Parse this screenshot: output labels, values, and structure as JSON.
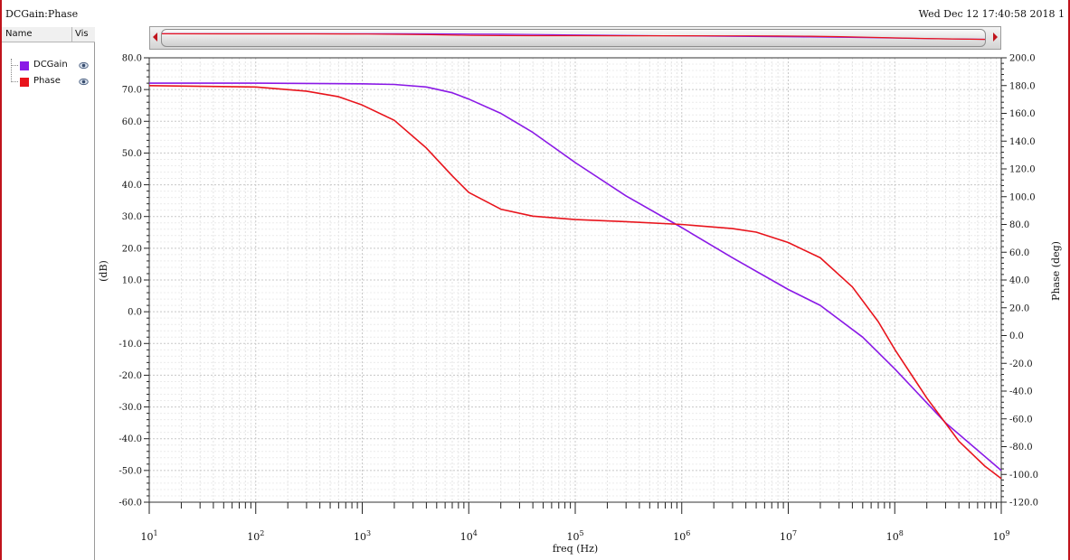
{
  "header": {
    "title": "DCGain:Phase",
    "timestamp": "Wed Dec 12 17:40:58 2018  1"
  },
  "legend": {
    "col_name": "Name",
    "col_vis": "Vis",
    "items": [
      {
        "label": "DCGain",
        "color": "#8a19e6",
        "icon": "eye-icon"
      },
      {
        "label": "Phase",
        "color": "#e8141c",
        "icon": "eye-icon"
      }
    ]
  },
  "chart_data": {
    "type": "line",
    "xlabel": "freq (Hz)",
    "ylabel_left": "(dB)",
    "ylabel_right": "Phase (deg)",
    "xscale": "log",
    "xlim": [
      10,
      1000000000
    ],
    "ylim_left": [
      -60,
      80
    ],
    "ylim_right": [
      -120,
      200
    ],
    "grid": true,
    "x_ticks": [
      "10",
      "10",
      "10",
      "10",
      "10",
      "10",
      "10",
      "10",
      "10"
    ],
    "x_tick_exponents": [
      "1",
      "2",
      "3",
      "4",
      "5",
      "6",
      "7",
      "8",
      "9"
    ],
    "y_ticks_left": [
      "80.0",
      "70.0",
      "60.0",
      "50.0",
      "40.0",
      "30.0",
      "20.0",
      "10.0",
      "0.0",
      "-10.0",
      "-20.0",
      "-30.0",
      "-40.0",
      "-50.0",
      "-60.0"
    ],
    "y_ticks_right": [
      "200.0",
      "180.0",
      "160.0",
      "140.0",
      "120.0",
      "100.0",
      "80.0",
      "60.0",
      "40.0",
      "20.0",
      "0.0",
      "-20.0",
      "-40.0",
      "-60.0",
      "-80.0",
      "-100.0",
      "-120.0"
    ],
    "series": [
      {
        "name": "DCGain",
        "color": "#8a19e6",
        "axis": "left",
        "x": [
          10,
          100,
          1000,
          2000,
          4000,
          7000,
          10000,
          20000,
          40000,
          100000,
          300000,
          1000000,
          3000000,
          10000000,
          20000000,
          50000000,
          100000000,
          300000000,
          1000000000
        ],
        "y": [
          72,
          72,
          71.8,
          71.6,
          70.8,
          69,
          67,
          62.5,
          56.5,
          47,
          36.5,
          26.5,
          17,
          7,
          2,
          -8,
          -18,
          -35,
          -50
        ]
      },
      {
        "name": "Phase",
        "color": "#e8141c",
        "axis": "right",
        "x": [
          10,
          100,
          300,
          600,
          1000,
          2000,
          4000,
          7000,
          10000,
          20000,
          40000,
          100000,
          300000,
          1000000,
          3000000,
          5000000,
          10000000,
          20000000,
          40000000,
          70000000,
          100000000,
          200000000,
          400000000,
          700000000,
          1000000000
        ],
        "y": [
          180,
          179,
          176,
          172,
          166,
          155,
          135,
          115,
          103,
          91,
          86,
          83.5,
          82,
          80,
          77,
          74.5,
          67,
          56,
          35,
          10,
          -10,
          -45,
          -76,
          -94,
          -103
        ]
      }
    ]
  }
}
